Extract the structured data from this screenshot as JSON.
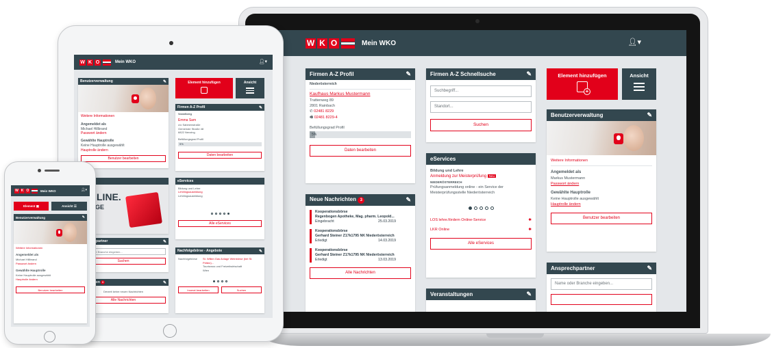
{
  "brand": {
    "logo_letters": [
      "W",
      "K",
      "O"
    ],
    "title": "Mein WKO",
    "primary_color": "#e2001a",
    "header_color": "#33474f"
  },
  "user_menu": {
    "icon": "user-icon",
    "caret": "▾"
  },
  "pencil_glyph": "✎",
  "laptop": {
    "firmen_profil": {
      "title": "Firmen A-Z Profil",
      "region": "Niederösterreich",
      "company": "Kaufhaus Markus Mustermann",
      "street": "Trattenweg 89",
      "city": "2801 Rainbach",
      "phone": "02481 8229",
      "fax": "02481 8229-4",
      "fill_label": "Befüllungsgrad Profil",
      "fill_value": "5%",
      "fill_fraction": 0.05,
      "button": "Daten bearbeiten"
    },
    "schnellsuche": {
      "title": "Firmen A-Z Schnellsuche",
      "search_placeholder": "Suchbegriff...",
      "location_placeholder": "Standort...",
      "button": "Suchen"
    },
    "add_element": {
      "label": "Element hinzufügen",
      "icon": "add-element-icon"
    },
    "view": {
      "label": "Ansicht",
      "icon": "hamburger-icon"
    },
    "benutzer": {
      "title": "Benutzerverwaltung",
      "more_info": "Weitere Informationen",
      "logged_in_label": "Angemeldet als",
      "user_name": "Markus Mustermann",
      "change_password": "Passwort ändern",
      "role_label": "Gewählte Hauptrolle",
      "role_value": "Keine Hauptrolle ausgewählt",
      "change_role": "Hauptrolle ändern",
      "button": "Benutzer bearbeiten"
    },
    "eservices": {
      "title": "eServices",
      "category": "Bildung und Lehre",
      "link": "Anmeldung zur Meisterprüfung",
      "link_badge": "Neu",
      "region": "NIEDERÖSTERREICH",
      "description": "Prüfungsanmeldung online - ein Service der Meisterprüfungsstelle Niederösterreich",
      "links": [
        "LOS lehre.fördern Online-Service",
        "LKR Online"
      ],
      "carousel": {
        "count": 5,
        "active": 0
      },
      "button": "Alle eServices"
    },
    "nachrichten": {
      "title": "Neue Nachrichten",
      "badge": "3",
      "items": [
        {
          "title": "Kooperationsbörse",
          "sender": "Regenbogen Apotheke, Mag. pharm. Leopold...",
          "status": "Eingebracht",
          "date": "25.03.2019"
        },
        {
          "title": "Kooperationsbörse",
          "sender": "Gerhard Steiner Z17k1795 NK Niederösterreich",
          "status": "Erledigt",
          "date": "14.03.2019"
        },
        {
          "title": "Kooperationsbörse",
          "sender": "Gerhard Steiner Z17k1795 NK Niederösterreich",
          "status": "Erledigt",
          "date": "13.03.2019"
        }
      ],
      "button": "Alle Nachrichten"
    },
    "veranstaltungen": {
      "title": "Veranstaltungen"
    },
    "ansprechpartner": {
      "title": "Ansprechpartner",
      "placeholder": "Name oder Branche eingeben..."
    }
  },
  "tablet": {
    "benutzer_title": "Benutzerverwaltung",
    "more_info": "Weitere Informationen",
    "logged_in_label": "Angemeldet als",
    "user_name": "Michael Hillbrand",
    "change_password": "Passwort ändern",
    "role_label": "Gewählte Hauptrolle",
    "role_value": "Keine Hauptrolle ausgewählt",
    "change_role": "Hauptrolle ändern",
    "user_button": "Benutzer bearbeiten",
    "add_element": "Element hinzufügen",
    "view": "Ansicht",
    "profil_title": "Firmen A-Z Profil",
    "profil_region": "Vorarlberg",
    "profil_company": "Emma Sam",
    "profil_address": [
      "c/o Sabinenstraße",
      "Gemeinde Straße 48",
      "6822 Nenzing"
    ],
    "profil_fill_label": "Befüllungsgrad Profil",
    "profil_fill_value": "5%",
    "profil_button": "Daten bearbeiten",
    "online_text": "ONLINE.",
    "online_text2": "ERAGE",
    "eservices_title": "eServices",
    "eservices_category": "Bildung und Lehre",
    "eservices_link": "Lehrlingsausbildung",
    "eservices_text": "Lehrlingsausbildung",
    "eservices_button": "Alle eServices",
    "carousel": {
      "count": 5,
      "active": 4
    },
    "partner_title": "Ansprechpartner",
    "partner_placeholder": "Name oder Branche eingeben...",
    "partner_button": "Suchen",
    "news_title": "Nachrichten",
    "news_badge": "0",
    "news_empty": "Derzeit keine neuen Nachrichten",
    "news_button": "Alle Nachrichten",
    "boerse_title": "Nachfolgebörse - Angebote",
    "boerse_label": "Nachfolgebörse",
    "boerse_link": "St. Wilkin Gas Anlage Weinbörse (bei St. Pölten)...",
    "boerse_text": "Tourismus und Freizeitwirtschaft",
    "boerse_place": "Wien",
    "boerse_carousel": {
      "count": 4,
      "active": 0
    },
    "boerse_button_left": "Inserat bearbeiten",
    "boerse_button_right": "Suchen"
  },
  "phone": {
    "element": "Element",
    "view": "Ansicht",
    "benutzer_title": "Benutzerverwaltung",
    "more_info": "Weitere Informationen",
    "logged_in_label": "Angemeldet als",
    "user_name": "Michael Hillbrand",
    "change_password": "Passwort ändern",
    "role_label": "Gewählte Hauptrolle",
    "role_value": "Keine Hauptrolle ausgewählt",
    "change_role": "Hauptrolle ändern",
    "button": "Benutzer bearbeiten"
  }
}
